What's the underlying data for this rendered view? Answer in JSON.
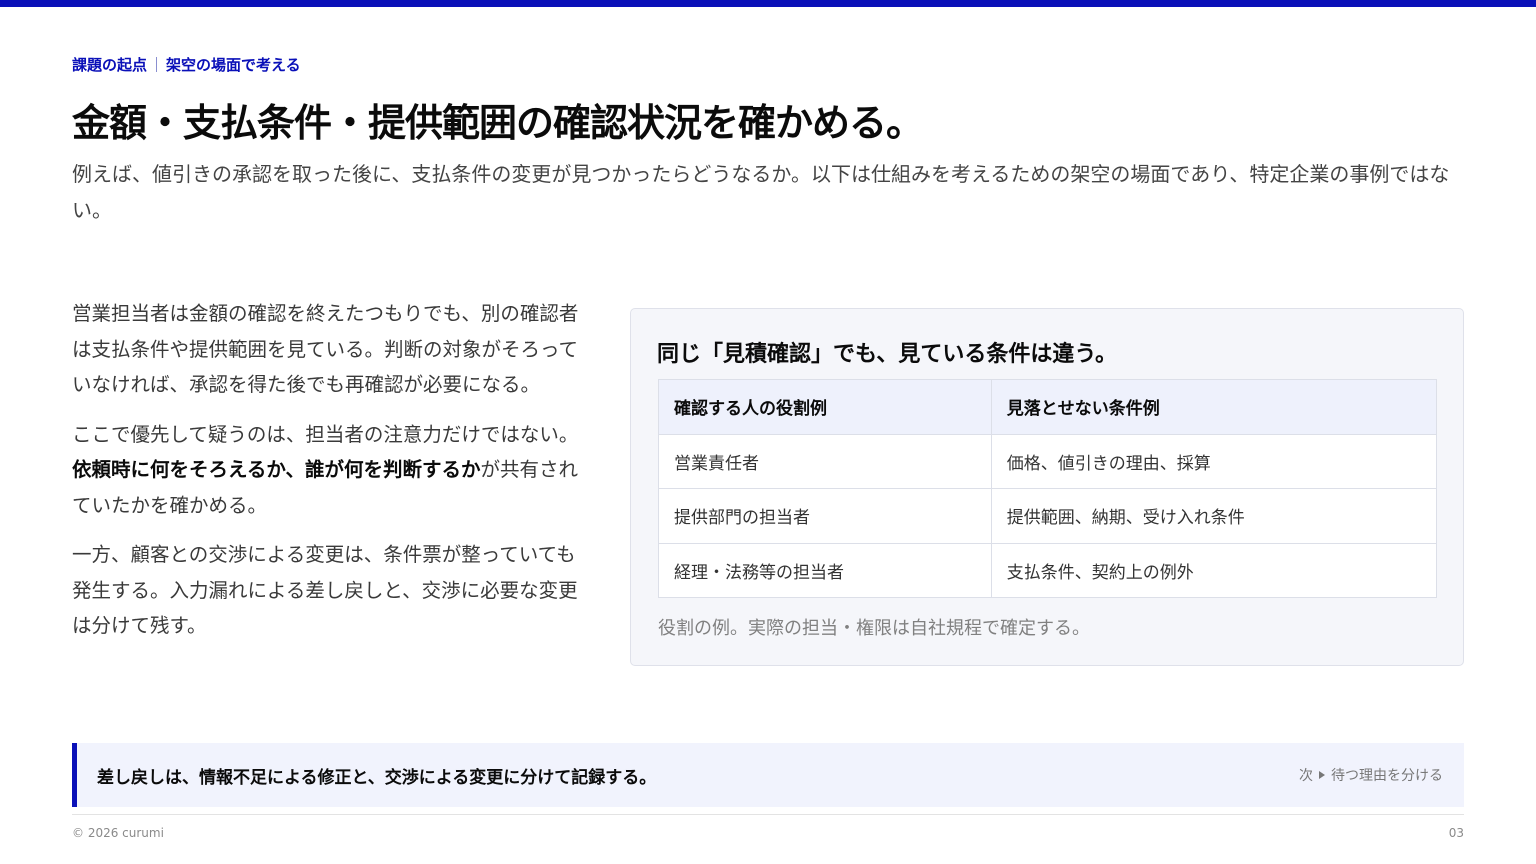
{
  "eyebrow": {
    "category": "課題の起点",
    "topic": "架空の場面で考える"
  },
  "title": "金額・支払条件・提供範囲の確認状況を確かめる。",
  "lead": "例えば、値引きの承認を取った後に、支払条件の変更が見つかったらどうなるか。以下は仕組みを考えるための架空の場面であり、特定企業の事例ではない。",
  "body": {
    "p1": "営業担当者は金額の確認を終えたつもりでも、別の確認者は支払条件や提供範囲を見ている。判断の対象がそろっていなければ、承認を得た後でも再確認が必要になる。",
    "p2_before": "ここで優先して疑うのは、担当者の注意力だけではない。",
    "p2_strong": "依頼時に何をそろえるか、誰が何を判断するか",
    "p2_after": "が共有されていたかを確かめる。",
    "p3": "一方、顧客との交渉による変更は、条件票が整っていても発生する。入力漏れによる差し戻しと、交渉に必要な変更は分けて残す。"
  },
  "card": {
    "title": "同じ「見積確認」でも、見ている条件は違う。",
    "headers": [
      "確認する人の役割例",
      "見落とせない条件例"
    ],
    "rows": [
      [
        "営業責任者",
        "価格、値引きの理由、採算"
      ],
      [
        "提供部門の担当者",
        "提供範囲、納期、受け入れ条件"
      ],
      [
        "経理・法務等の担当者",
        "支払条件、契約上の例外"
      ]
    ],
    "note": "役割の例。実際の担当・権限は自社規程で確定する。"
  },
  "callout": {
    "text": "差し戻しは、情報不足による修正と、交渉による変更に分けて記録する。",
    "next_prefix": "次",
    "next_label": "待つ理由を分ける"
  },
  "footer": {
    "copyright": "© 2026 curumi",
    "page": "03"
  },
  "colors": {
    "accent": "#0a10b8",
    "callout_bg": "#f1f3fd",
    "card_bg": "#f5f6fa",
    "table_header_bg": "#eef1fc"
  }
}
